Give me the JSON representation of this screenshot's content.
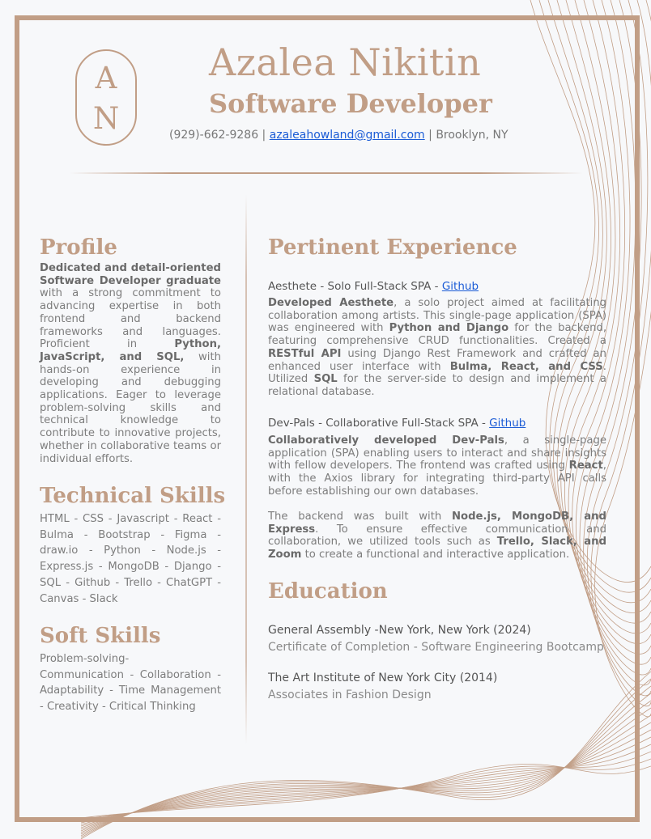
{
  "header": {
    "monogram_top": "A",
    "monogram_bottom": "N",
    "name": "Azalea Nikitin",
    "role": "Software Developer",
    "phone": "(929)-662-9286",
    "sep1": " | ",
    "email": "azaleahowland@gmail.com",
    "sep2": " | ",
    "location": "Brooklyn, NY"
  },
  "profile": {
    "heading": "Profile",
    "text_parts": [
      {
        "b": true,
        "t": "Dedicated and detail-oriented Software Developer graduate"
      },
      {
        "b": false,
        "t": " with a strong commitment to advancing expertise in both frontend and backend frameworks and languages. Proficient in "
      },
      {
        "b": true,
        "t": "Python, JavaScript, and SQL,"
      },
      {
        "b": false,
        "t": " with hands-on experience in developing and debugging applications. Eager to leverage problem-solving skills and technical knowledge to contribute to innovative projects, whether in collaborative teams or individual efforts."
      }
    ]
  },
  "technical_skills": {
    "heading": "Technical Skills",
    "text": "HTML - CSS - Javascript - React - Bulma - Bootstrap - Figma - draw.io - Python - Node.js - Express.js - MongoDB - Django - SQL - Github - Trello - ChatGPT - Canvas - Slack"
  },
  "soft_skills": {
    "heading": "Soft Skills",
    "line1": "Problem-solving-",
    "text": "Communication - Collaboration - Adaptability - Time Management - Creativity - Critical Thinking"
  },
  "experience": {
    "heading": "Pertinent Experience",
    "jobs": [
      {
        "title": "Aesthete - Solo Full-Stack SPA - ",
        "link": "Github",
        "paragraphs": [
          [
            {
              "b": true,
              "t": "Developed Aesthete"
            },
            {
              "b": false,
              "t": ", a solo project aimed at facilitating collaboration among artists. This single-page application (SPA) was engineered with "
            },
            {
              "b": true,
              "t": "Python and Django"
            },
            {
              "b": false,
              "t": " for the backend, featuring comprehensive CRUD functionalities. Created a "
            },
            {
              "b": true,
              "t": "RESTful API"
            },
            {
              "b": false,
              "t": " using Django Rest Framework and crafted an enhanced user interface with "
            },
            {
              "b": true,
              "t": "Bulma, React, and CSS"
            },
            {
              "b": false,
              "t": ". Utilized "
            },
            {
              "b": true,
              "t": "SQL"
            },
            {
              "b": false,
              "t": " for the server-side to design and implement a relational database."
            }
          ]
        ]
      },
      {
        "title": "Dev-Pals - Collaborative Full-Stack SPA - ",
        "link": "Github",
        "paragraphs": [
          [
            {
              "b": true,
              "t": "Collaboratively developed Dev-Pals"
            },
            {
              "b": false,
              "t": ", a single-page application (SPA) enabling users to interact and share insights with fellow developers. The frontend was crafted using "
            },
            {
              "b": true,
              "t": "React"
            },
            {
              "b": false,
              "t": ", with the Axios library for integrating third-party API calls before establishing our own databases."
            }
          ],
          [
            {
              "b": false,
              "t": "The backend was built with "
            },
            {
              "b": true,
              "t": "Node.js, MongoDB, and Express"
            },
            {
              "b": false,
              "t": ". To ensure effective communication and collaboration, we utilized tools such as "
            },
            {
              "b": true,
              "t": "Trello, Slack, and Zoom"
            },
            {
              "b": false,
              "t": " to create a functional and interactive application."
            }
          ]
        ]
      }
    ]
  },
  "education": {
    "heading": "Education",
    "items": [
      {
        "title": "General Assembly -New York, New York (2024)",
        "sub": "Certificate of Completion - Software Engineering Bootcamp"
      },
      {
        "title": "The Art Institute of New York City (2014)",
        "sub": "Associates in Fashion Design"
      }
    ]
  },
  "colors": {
    "accent": "#c19e86",
    "link": "#1a5bd6",
    "background": "#f7f8fa"
  }
}
